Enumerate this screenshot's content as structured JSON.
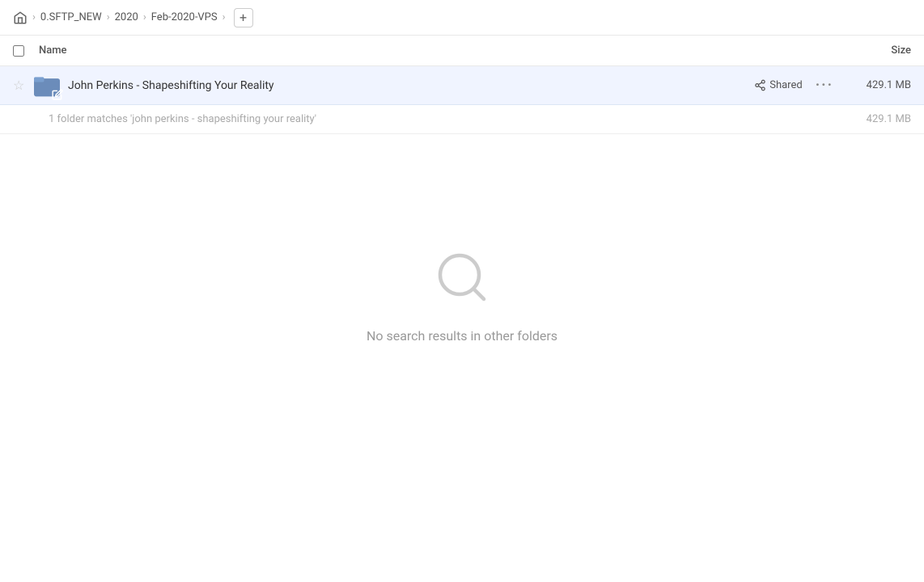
{
  "header": {
    "home_label": "home",
    "breadcrumb": [
      {
        "label": "0.SFTP_NEW"
      },
      {
        "label": "2020"
      },
      {
        "label": "Feb-2020-VPS"
      }
    ],
    "add_button_label": "+"
  },
  "columns": {
    "name_label": "Name",
    "size_label": "Size"
  },
  "file_row": {
    "name": "John Perkins - Shapeshifting Your Reality",
    "shared_label": "Shared",
    "size": "429.1 MB"
  },
  "match_info": {
    "text": "1 folder matches 'john perkins - shapeshifting your reality'",
    "size": "429.1 MB"
  },
  "empty_state": {
    "message": "No search results in other folders"
  }
}
